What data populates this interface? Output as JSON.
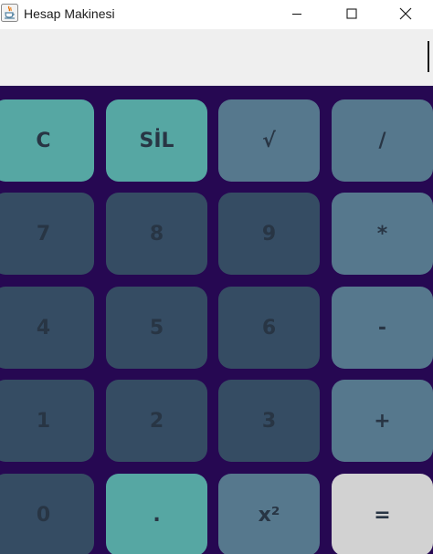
{
  "window": {
    "title": "Hesap Makinesi",
    "controls": [
      "minimize",
      "maximize",
      "close"
    ]
  },
  "display": {
    "value": "",
    "placeholder": ""
  },
  "colors": {
    "keypad_background": "#260852",
    "teal_key": "#56a7a3",
    "grey_key": "#56788d",
    "dark_key": "#354c63",
    "light_key": "#d2d2d2",
    "key_text": "#283544"
  },
  "keys": {
    "clear": "C",
    "delete": "SİL",
    "sqrt": "√",
    "divide": "/",
    "seven": "7",
    "eight": "8",
    "nine": "9",
    "multiply": "*",
    "four": "4",
    "five": "5",
    "six": "6",
    "subtract": "-",
    "one": "1",
    "two": "2",
    "three": "3",
    "add": "+",
    "zero": "0",
    "decimal": ".",
    "square": "x²",
    "equals": "="
  }
}
